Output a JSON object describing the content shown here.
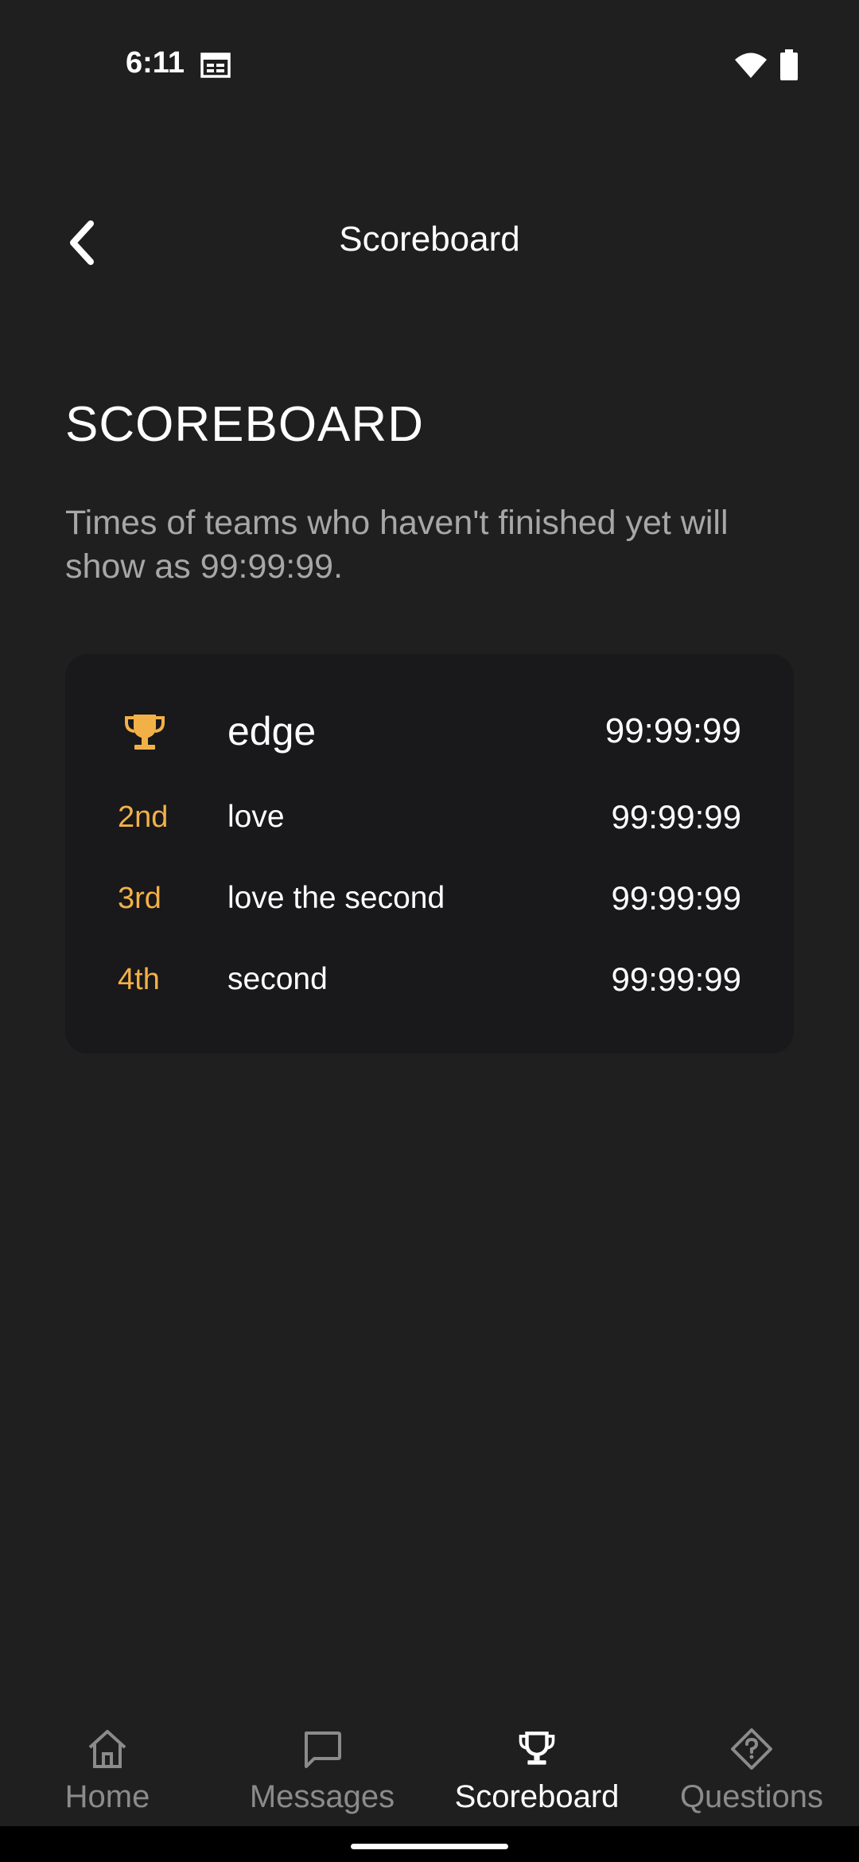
{
  "status_bar": {
    "time": "6:11"
  },
  "app_bar": {
    "title": "Scoreboard"
  },
  "heading": "SCOREBOARD",
  "subtitle": "Times of teams who haven't finished yet will show as 99:99:99.",
  "rows": [
    {
      "rank": "",
      "team": "edge",
      "time": "99:99:99"
    },
    {
      "rank": "2nd",
      "team": "love",
      "time": "99:99:99"
    },
    {
      "rank": "3rd",
      "team": "love the second",
      "time": "99:99:99"
    },
    {
      "rank": "4th",
      "team": "second",
      "time": "99:99:99"
    }
  ],
  "bottom_nav": [
    {
      "label": "Home",
      "icon": "home-icon",
      "active": false
    },
    {
      "label": "Messages",
      "icon": "message-icon",
      "active": false
    },
    {
      "label": "Scoreboard",
      "icon": "trophy-icon",
      "active": true
    },
    {
      "label": "Questions",
      "icon": "question-diamond-icon",
      "active": false
    }
  ],
  "colors": {
    "background": "#201f20",
    "card": "#19181a",
    "accent": "#f2b147",
    "muted_text": "#a8a7a8",
    "nav_inactive": "#8c8b8c"
  }
}
